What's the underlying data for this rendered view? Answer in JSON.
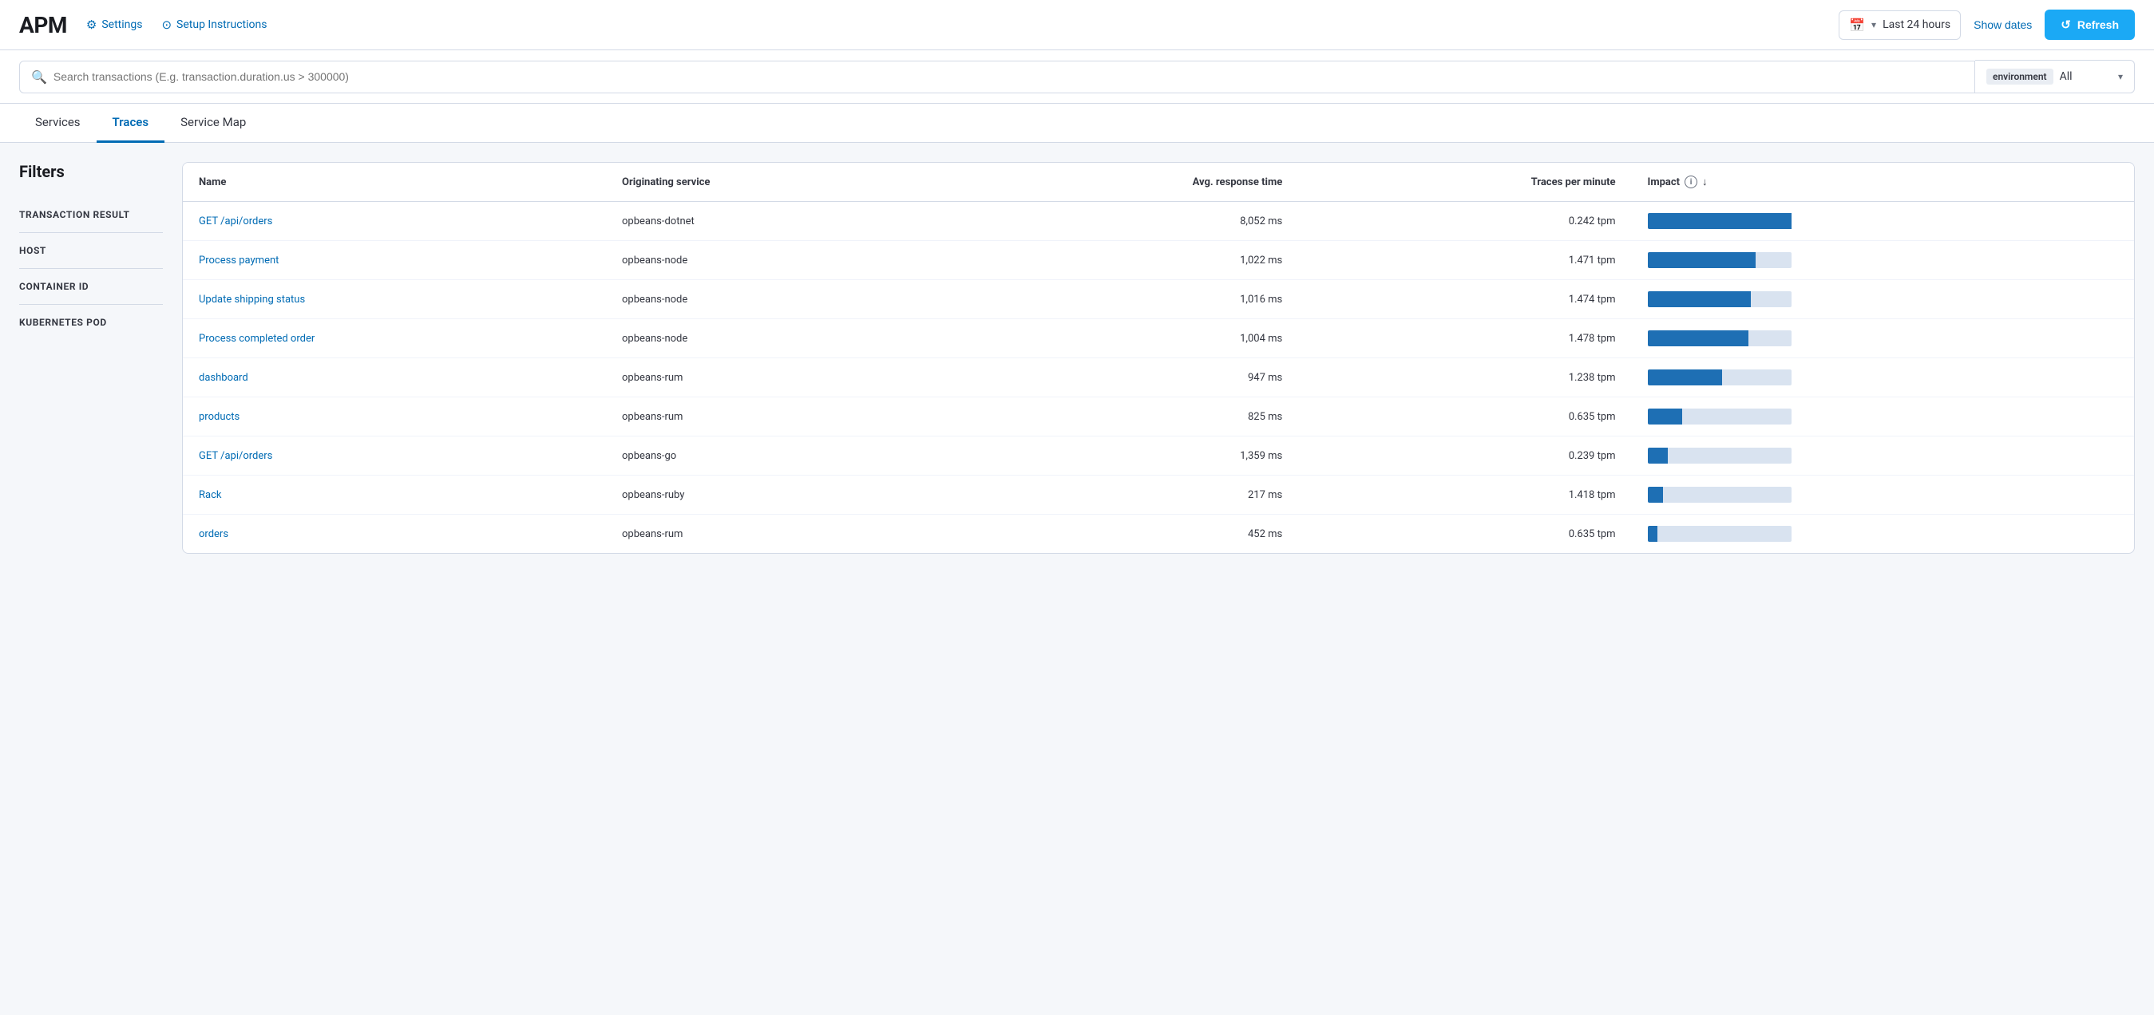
{
  "header": {
    "app_title": "APM",
    "nav_links": [
      {
        "id": "settings",
        "label": "Settings",
        "icon": "gear"
      },
      {
        "id": "setup",
        "label": "Setup Instructions",
        "icon": "setup"
      }
    ],
    "time_range": "Last 24 hours",
    "show_dates_label": "Show dates",
    "refresh_label": "Refresh"
  },
  "search": {
    "placeholder": "Search transactions (E.g. transaction.duration.us > 300000)",
    "env_label": "environment",
    "env_value": "All"
  },
  "tabs": [
    {
      "id": "services",
      "label": "Services",
      "active": false
    },
    {
      "id": "traces",
      "label": "Traces",
      "active": true
    },
    {
      "id": "service-map",
      "label": "Service Map",
      "active": false
    }
  ],
  "filters": {
    "title": "Filters",
    "items": [
      {
        "id": "transaction-result",
        "label": "TRANSACTION RESULT"
      },
      {
        "id": "host",
        "label": "HOST"
      },
      {
        "id": "container-id",
        "label": "CONTAINER ID"
      },
      {
        "id": "kubernetes-pod",
        "label": "KUBERNETES POD"
      }
    ]
  },
  "table": {
    "columns": [
      {
        "id": "name",
        "label": "Name"
      },
      {
        "id": "originating-service",
        "label": "Originating service"
      },
      {
        "id": "avg-response-time",
        "label": "Avg. response time"
      },
      {
        "id": "traces-per-minute",
        "label": "Traces per minute"
      },
      {
        "id": "impact",
        "label": "Impact",
        "sortable": true,
        "info": true
      }
    ],
    "rows": [
      {
        "name": "GET /api/orders",
        "originating_service": "opbeans-dotnet",
        "avg_response_time": "8,052 ms",
        "traces_per_minute": "0.242 tpm",
        "impact_fill": 100,
        "impact_empty": 0
      },
      {
        "name": "Process payment",
        "originating_service": "opbeans-node",
        "avg_response_time": "1,022 ms",
        "traces_per_minute": "1.471 tpm",
        "impact_fill": 75,
        "impact_empty": 25
      },
      {
        "name": "Update shipping status",
        "originating_service": "opbeans-node",
        "avg_response_time": "1,016 ms",
        "traces_per_minute": "1.474 tpm",
        "impact_fill": 72,
        "impact_empty": 28
      },
      {
        "name": "Process completed order",
        "originating_service": "opbeans-node",
        "avg_response_time": "1,004 ms",
        "traces_per_minute": "1.478 tpm",
        "impact_fill": 70,
        "impact_empty": 30
      },
      {
        "name": "dashboard",
        "originating_service": "opbeans-rum",
        "avg_response_time": "947 ms",
        "traces_per_minute": "1.238 tpm",
        "impact_fill": 52,
        "impact_empty": 48
      },
      {
        "name": "products",
        "originating_service": "opbeans-rum",
        "avg_response_time": "825 ms",
        "traces_per_minute": "0.635 tpm",
        "impact_fill": 24,
        "impact_empty": 76
      },
      {
        "name": "GET /api/orders",
        "originating_service": "opbeans-go",
        "avg_response_time": "1,359 ms",
        "traces_per_minute": "0.239 tpm",
        "impact_fill": 14,
        "impact_empty": 86
      },
      {
        "name": "Rack",
        "originating_service": "opbeans-ruby",
        "avg_response_time": "217 ms",
        "traces_per_minute": "1.418 tpm",
        "impact_fill": 11,
        "impact_empty": 89
      },
      {
        "name": "orders",
        "originating_service": "opbeans-rum",
        "avg_response_time": "452 ms",
        "traces_per_minute": "0.635 tpm",
        "impact_fill": 7,
        "impact_empty": 93
      }
    ]
  }
}
